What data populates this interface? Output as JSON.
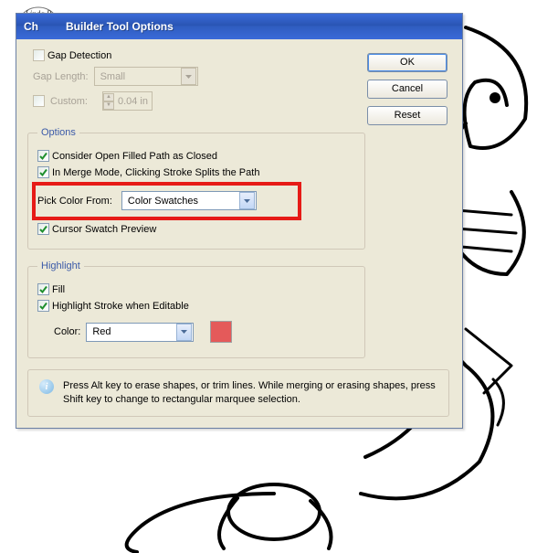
{
  "title": "Builder Tool Options",
  "buttons": {
    "ok": "OK",
    "cancel": "Cancel",
    "reset": "Reset"
  },
  "gap": {
    "detection": "Gap Detection",
    "lengthLabel": "Gap Length:",
    "lengthValue": "Small",
    "customLabel": "Custom:",
    "customValue": "0.04 in"
  },
  "options": {
    "legend": "Options",
    "considerOpen": "Consider Open Filled Path as Closed",
    "mergeMode": "In Merge Mode, Clicking Stroke Splits the Path",
    "pickColorLabel": "Pick Color From:",
    "pickColorValue": "Color Swatches",
    "cursorSwatch": "Cursor Swatch Preview"
  },
  "highlight": {
    "legend": "Highlight",
    "fill": "Fill",
    "stroke": "Highlight Stroke when Editable",
    "colorLabel": "Color:",
    "colorValue": "Red",
    "colorHex": "#e45a5a"
  },
  "tip": "Press Alt key to erase shapes, or trim lines. While merging or erasing shapes, press Shift key to change to rectangular marquee selection.",
  "badge": "Feather",
  "titlePrefix": "Ch"
}
